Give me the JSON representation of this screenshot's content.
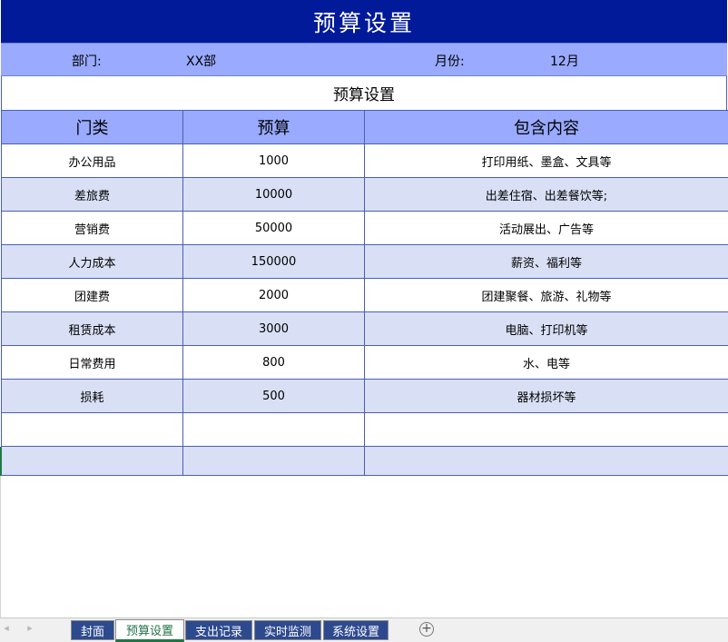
{
  "title": "预算设置",
  "info": {
    "dept_label": "部门:",
    "dept_value": "XX部",
    "month_label": "月份:",
    "month_value": "12月"
  },
  "subtitle": "预算设置",
  "table": {
    "headers": [
      "门类",
      "预算",
      "包含内容"
    ],
    "rows": [
      [
        "办公用品",
        "1000",
        "打印用纸、墨盒、文具等"
      ],
      [
        "差旅费",
        "10000",
        "出差住宿、出差餐饮等;"
      ],
      [
        "营销费",
        "50000",
        "活动展出、广告等"
      ],
      [
        "人力成本",
        "150000",
        "薪资、福利等"
      ],
      [
        "团建费",
        "2000",
        "团建聚餐、旅游、礼物等"
      ],
      [
        "租赁成本",
        "3000",
        "电脑、打印机等"
      ],
      [
        "日常费用",
        "800",
        "水、电等"
      ],
      [
        "损耗",
        "500",
        "器材损坏等"
      ],
      [
        "",
        "",
        ""
      ],
      [
        "",
        "",
        ""
      ]
    ]
  },
  "tabs": [
    {
      "label": "封面",
      "active": false
    },
    {
      "label": "预算设置",
      "active": true
    },
    {
      "label": "支出记录",
      "active": false
    },
    {
      "label": "实时监测",
      "active": false
    },
    {
      "label": "系统设置",
      "active": false
    }
  ],
  "icons": {
    "nav_prev": "◂",
    "nav_next": "▸",
    "add_sheet": "+"
  },
  "colors": {
    "title_bg": "#001a99",
    "header_bg": "#99aaff",
    "alt_row_bg": "#d9e0f5",
    "tab_bg": "#2e4a8f",
    "active_tab_accent": "#217346"
  }
}
